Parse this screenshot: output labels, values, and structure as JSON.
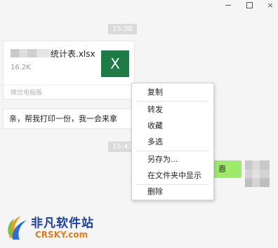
{
  "window": {
    "minimize_icon": "minimize-icon",
    "maximize_icon": "maximize-icon",
    "close_label": "×"
  },
  "chat": {
    "timestamps": [
      "15:38",
      "15:43"
    ],
    "file_message": {
      "name": "统计表.xlsx",
      "size": "16.2K",
      "icon_label": "X",
      "source": "微信电脑版",
      "icon_color": "#1e7b45"
    },
    "text_message": "亲，帮我打印一份，我一会来拿",
    "sent_message": "恩",
    "sent_bubble_color": "#9eea6a"
  },
  "context_menu": {
    "items": [
      "复制",
      "转发",
      "收藏",
      "多选",
      "另存为...",
      "在文件夹中显示",
      "删除"
    ]
  },
  "watermark": {
    "cn": "非凡软件站",
    "en": "CRSKY.com"
  }
}
